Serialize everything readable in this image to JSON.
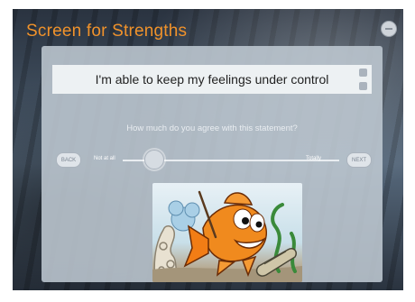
{
  "app": {
    "title": "Screen for Strengths"
  },
  "statement": {
    "text": "I'm able to keep my feelings under control"
  },
  "question": {
    "text": "How much do you agree with this statement?"
  },
  "navigation": {
    "back_label": "BACK",
    "next_label": "NEXT"
  },
  "scale": {
    "min_label": "Not at all",
    "max_label": "Totally",
    "value_fraction": 0.14
  },
  "colors": {
    "title": "#f0922b",
    "panel": "#bec8d2"
  },
  "icons": [
    "close-icon",
    "arrow-up-icon",
    "arrow-down-icon"
  ]
}
